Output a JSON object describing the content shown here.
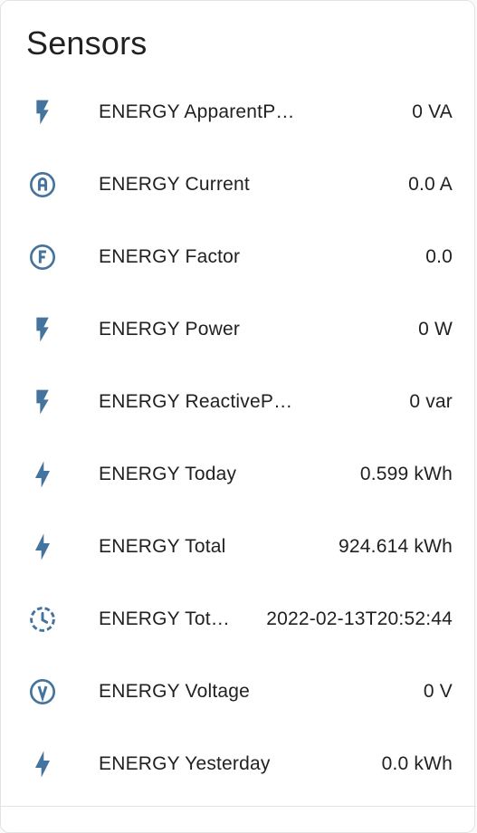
{
  "card": {
    "title": "Sensors"
  },
  "colors": {
    "icon": "#44739e",
    "text": "#212121",
    "border": "#e3e3e3"
  },
  "sensors": [
    {
      "icon": "flash-icon",
      "name": "ENERGY ApparentPower",
      "value": "0 VA"
    },
    {
      "icon": "alpha-a-circle-icon",
      "name": "ENERGY Current",
      "value": "0.0 A"
    },
    {
      "icon": "alpha-f-circle-icon",
      "name": "ENERGY Factor",
      "value": "0.0"
    },
    {
      "icon": "flash-icon",
      "name": "ENERGY Power",
      "value": "0 W"
    },
    {
      "icon": "flash-icon",
      "name": "ENERGY ReactivePower",
      "value": "0 var"
    },
    {
      "icon": "lightning-bolt-icon",
      "name": "ENERGY Today",
      "value": "0.599 kWh"
    },
    {
      "icon": "lightning-bolt-icon",
      "name": "ENERGY Total",
      "value": "924.614 kWh"
    },
    {
      "icon": "clock-dashed-icon",
      "name": "ENERGY Tot…",
      "value": "2022-02-13T20:52:44"
    },
    {
      "icon": "alpha-v-circle-icon",
      "name": "ENERGY Voltage",
      "value": "0 V"
    },
    {
      "icon": "lightning-bolt-icon",
      "name": "ENERGY Yesterday",
      "value": "0.0 kWh"
    }
  ]
}
